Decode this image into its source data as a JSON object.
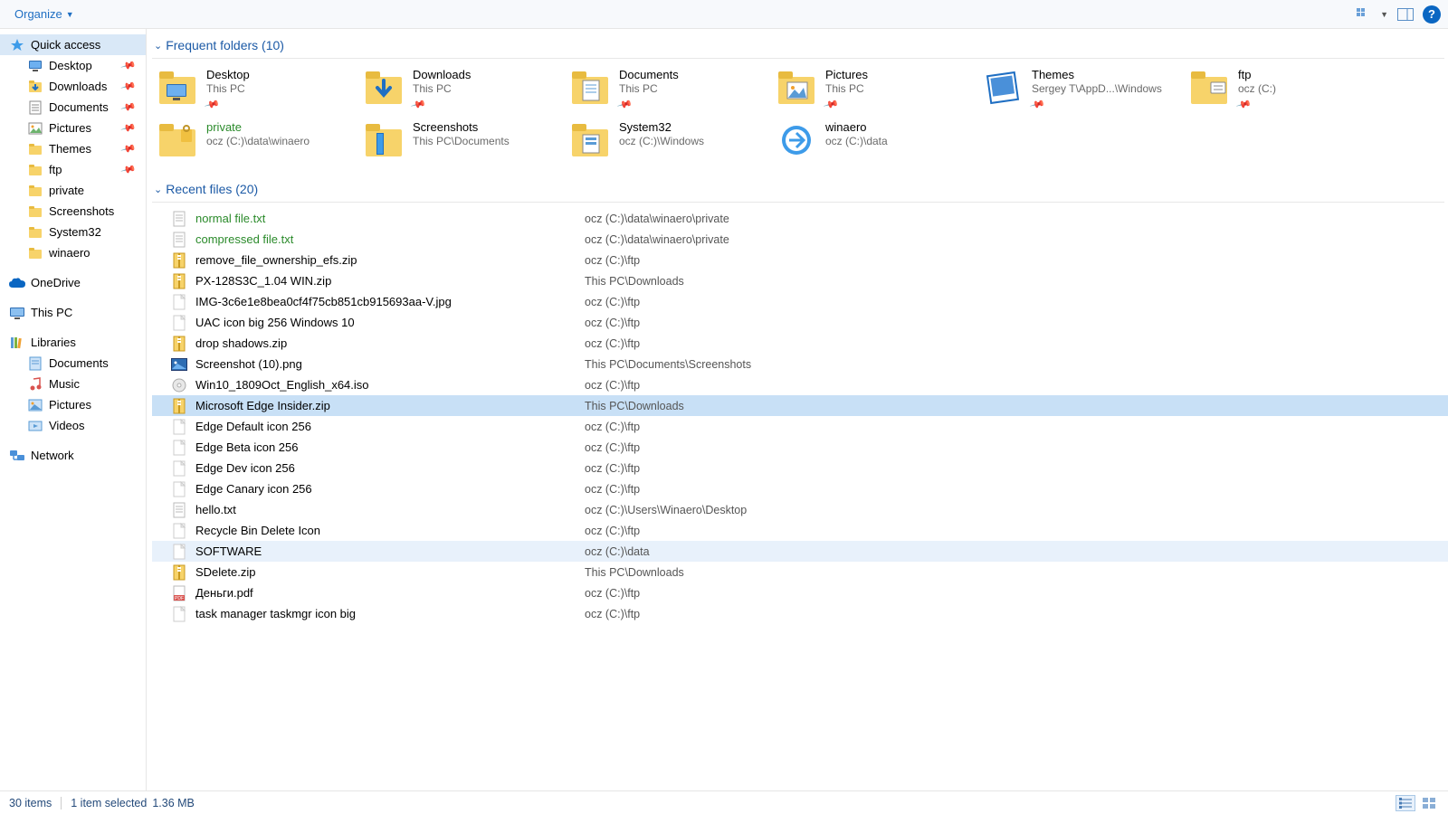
{
  "toolbar": {
    "organize": "Organize"
  },
  "nav": {
    "quick_access": "Quick access",
    "pinned": [
      {
        "label": "Desktop",
        "icon": "desktop"
      },
      {
        "label": "Downloads",
        "icon": "downloads"
      },
      {
        "label": "Documents",
        "icon": "documents"
      },
      {
        "label": "Pictures",
        "icon": "pictures"
      },
      {
        "label": "Themes",
        "icon": "folder"
      },
      {
        "label": "ftp",
        "icon": "folder"
      }
    ],
    "recent": [
      {
        "label": "private",
        "icon": "folder"
      },
      {
        "label": "Screenshots",
        "icon": "folder"
      },
      {
        "label": "System32",
        "icon": "folder"
      },
      {
        "label": "winaero",
        "icon": "folder"
      }
    ],
    "onedrive": "OneDrive",
    "thispc": "This PC",
    "libraries": "Libraries",
    "lib_items": [
      {
        "label": "Documents",
        "icon": "lib-doc"
      },
      {
        "label": "Music",
        "icon": "lib-music"
      },
      {
        "label": "Pictures",
        "icon": "lib-pic"
      },
      {
        "label": "Videos",
        "icon": "lib-vid"
      }
    ],
    "network": "Network"
  },
  "groups": {
    "folders_title": "Frequent folders (10)",
    "files_title": "Recent files (20)"
  },
  "folders": [
    {
      "name": "Desktop",
      "sub": "This PC",
      "icon": "desktop-big",
      "pin": true
    },
    {
      "name": "Downloads",
      "sub": "This PC",
      "icon": "downloads-big",
      "pin": true
    },
    {
      "name": "Documents",
      "sub": "This PC",
      "icon": "documents-big",
      "pin": true
    },
    {
      "name": "Pictures",
      "sub": "This PC",
      "icon": "pictures-big",
      "pin": true
    },
    {
      "name": "Themes",
      "sub": "Sergey T\\AppD...\\Windows",
      "icon": "themes-big",
      "pin": true
    },
    {
      "name": "ftp",
      "sub": "ocz (C:)",
      "icon": "ftp-big",
      "pin": true
    },
    {
      "name": "private",
      "sub": "ocz (C:)\\data\\winaero",
      "icon": "private-big",
      "pin": false,
      "green": true
    },
    {
      "name": "Screenshots",
      "sub": "This PC\\Documents",
      "icon": "screenshots-big",
      "pin": false
    },
    {
      "name": "System32",
      "sub": "ocz (C:)\\Windows",
      "icon": "system32-big",
      "pin": false
    },
    {
      "name": "winaero",
      "sub": "ocz (C:)\\data",
      "icon": "winaero-big",
      "pin": false
    }
  ],
  "files": [
    {
      "name": "normal file.txt",
      "path": "ocz (C:)\\data\\winaero\\private",
      "icon": "txt",
      "green": true
    },
    {
      "name": "compressed file.txt",
      "path": "ocz (C:)\\data\\winaero\\private",
      "icon": "txt",
      "green": true
    },
    {
      "name": "remove_file_ownership_efs.zip",
      "path": "ocz (C:)\\ftp",
      "icon": "zip"
    },
    {
      "name": "PX-128S3C_1.04 WIN.zip",
      "path": "This PC\\Downloads",
      "icon": "zip"
    },
    {
      "name": "IMG-3c6e1e8bea0cf4f75cb851cb915693aa-V.jpg",
      "path": "ocz (C:)\\ftp",
      "icon": "file"
    },
    {
      "name": "UAC icon big 256 Windows 10",
      "path": "ocz (C:)\\ftp",
      "icon": "file"
    },
    {
      "name": "drop shadows.zip",
      "path": "ocz (C:)\\ftp",
      "icon": "zip"
    },
    {
      "name": "Screenshot (10).png",
      "path": "This PC\\Documents\\Screenshots",
      "icon": "png"
    },
    {
      "name": "Win10_1809Oct_English_x64.iso",
      "path": "ocz (C:)\\ftp",
      "icon": "iso"
    },
    {
      "name": "Microsoft Edge Insider.zip",
      "path": "This PC\\Downloads",
      "icon": "zip",
      "selected": true
    },
    {
      "name": "Edge Default icon 256",
      "path": "ocz (C:)\\ftp",
      "icon": "file"
    },
    {
      "name": "Edge Beta icon 256",
      "path": "ocz (C:)\\ftp",
      "icon": "file"
    },
    {
      "name": "Edge Dev icon 256",
      "path": "ocz (C:)\\ftp",
      "icon": "file"
    },
    {
      "name": "Edge Canary icon 256",
      "path": "ocz (C:)\\ftp",
      "icon": "file"
    },
    {
      "name": "hello.txt",
      "path": "ocz (C:)\\Users\\Winaero\\Desktop",
      "icon": "txt"
    },
    {
      "name": "Recycle Bin Delete Icon",
      "path": "ocz (C:)\\ftp",
      "icon": "file"
    },
    {
      "name": "SOFTWARE",
      "path": "ocz (C:)\\data",
      "icon": "file",
      "hover": true
    },
    {
      "name": "SDelete.zip",
      "path": "This PC\\Downloads",
      "icon": "zip"
    },
    {
      "name": "Деньги.pdf",
      "path": "ocz (C:)\\ftp",
      "icon": "pdf"
    },
    {
      "name": "task manager taskmgr icon big",
      "path": "ocz (C:)\\ftp",
      "icon": "file"
    }
  ],
  "status": {
    "count": "30 items",
    "selection": "1 item selected",
    "size": "1.36 MB"
  }
}
